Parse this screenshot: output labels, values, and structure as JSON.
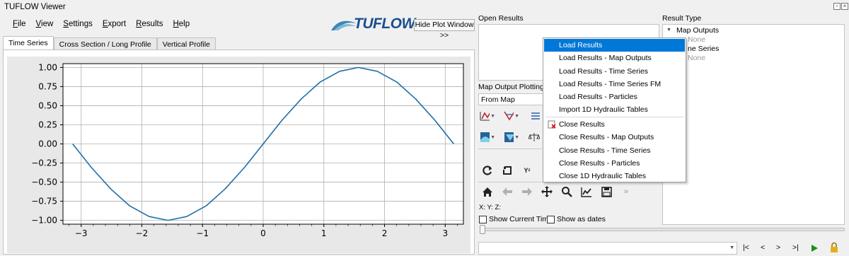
{
  "window": {
    "title": "TUFLOW Viewer"
  },
  "menu": [
    {
      "pre": "",
      "ul": "F",
      "post": "ile"
    },
    {
      "pre": "",
      "ul": "V",
      "post": "iew"
    },
    {
      "pre": "",
      "ul": "S",
      "post": "ettings"
    },
    {
      "pre": "",
      "ul": "E",
      "post": "xport"
    },
    {
      "pre": "",
      "ul": "R",
      "post": "esults"
    },
    {
      "pre": "",
      "ul": "H",
      "post": "elp"
    }
  ],
  "logo": {
    "text": "TUFLOW"
  },
  "hide_plot_button": "Hide Plot Window >>",
  "tabs": [
    {
      "label": "Time Series",
      "active": true
    },
    {
      "label": "Cross Section / Long Profile",
      "active": false
    },
    {
      "label": "Vertical Profile",
      "active": false
    }
  ],
  "chart_data": {
    "type": "line",
    "title": "",
    "xlabel": "",
    "ylabel": "",
    "xlim": [
      -3.3,
      3.3
    ],
    "ylim": [
      -1.05,
      1.05
    ],
    "grid": true,
    "color": "#1f6fa8",
    "x_ticks": [
      -3,
      -2,
      -1,
      0,
      1,
      2,
      3
    ],
    "x_tick_labels": [
      "−3",
      "−2",
      "−1",
      "0",
      "1",
      "2",
      "3"
    ],
    "y_ticks": [
      1.0,
      0.75,
      0.5,
      0.25,
      0.0,
      -0.25,
      -0.5,
      -0.75,
      -1.0
    ],
    "y_tick_labels": [
      "1.00",
      "0.75",
      "0.50",
      "0.25",
      "0.00",
      "−0.25",
      "−0.50",
      "−0.75",
      "−1.00"
    ],
    "series": [
      {
        "x": [
          -3.14,
          -2.83,
          -2.51,
          -2.2,
          -1.88,
          -1.57,
          -1.26,
          -0.94,
          -0.63,
          -0.31,
          0.0,
          0.31,
          0.63,
          0.94,
          1.26,
          1.57,
          1.88,
          2.2,
          2.51,
          2.83,
          3.14
        ],
        "y": [
          0.0,
          -0.31,
          -0.59,
          -0.81,
          -0.95,
          -1.0,
          -0.95,
          -0.81,
          -0.59,
          -0.31,
          0.0,
          0.31,
          0.59,
          0.81,
          0.95,
          1.0,
          0.95,
          0.81,
          0.59,
          0.31,
          0.0
        ]
      }
    ]
  },
  "open_results": {
    "label": "Open Results"
  },
  "map_output_plotting": {
    "label": "Map Output Plotting",
    "combo_value": "From Map"
  },
  "result_type": {
    "label": "Result Type",
    "tree": {
      "map_outputs": "Map Outputs",
      "none_1": "None",
      "time_series_partial": "ne Series",
      "none_2": "None"
    }
  },
  "context_menu": {
    "items": [
      {
        "label": "Load Results",
        "highlighted": true
      },
      {
        "label": "Load Results - Map Outputs"
      },
      {
        "label": "Load Results - Time Series"
      },
      {
        "label": "Load Results - Time Series FM"
      },
      {
        "label": "Load Results - Particles"
      },
      {
        "label": "Import 1D Hydraulic Tables"
      },
      {
        "label": "Close Results",
        "icon": "close-results-icon"
      },
      {
        "label": "Close Results - Map Outputs"
      },
      {
        "label": "Close Results - Time Series"
      },
      {
        "label": "Close Results - Particles"
      },
      {
        "label": "Close 1D Hydraulic Tables"
      }
    ]
  },
  "coords": {
    "text": "X:  Y:  Z:"
  },
  "show_current_time": "Show Current Time",
  "show_as_dates": "Show as dates",
  "overflow_chevron": "»",
  "playback": {
    "first": "|<",
    "prev": "<",
    "next": ">",
    "last": ">|"
  },
  "colors": {
    "highlight": "#0078d7",
    "line": "#1f6fa8",
    "play": "#1a8f1a"
  }
}
